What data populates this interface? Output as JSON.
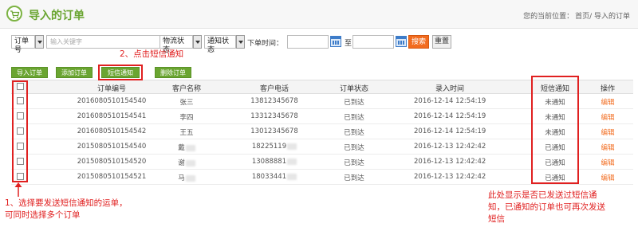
{
  "header": {
    "title": "导入的订单",
    "breadcrumb_prefix": "您的当前位置：",
    "breadcrumb_path": "首页/ 导入的订单"
  },
  "filter": {
    "field_select": "订单号",
    "search_placeholder": "输入关键字",
    "logistics_select": "物流状态",
    "notify_select": "通知状态",
    "time_label": "下单时间：",
    "range_sep": "至",
    "search_button": "搜索",
    "reset_button": "重置"
  },
  "actions": {
    "import": "导入订单",
    "add": "添加订单",
    "sms": "短信通知",
    "delete": "删除订单"
  },
  "table": {
    "columns": [
      "订单编号",
      "客户名称",
      "客户电话",
      "订单状态",
      "录入时间",
      "短信通知",
      "操作"
    ],
    "rows": [
      {
        "order": "2016080510154540",
        "name": "张三",
        "phone": "13812345678",
        "status": "已到达",
        "time": "2016-12-14 12:54:19",
        "sms": "未通知",
        "op": "编辑"
      },
      {
        "order": "2016080510154541",
        "name": "李四",
        "phone": "13312345678",
        "status": "已到达",
        "time": "2016-12-14 12:54:19",
        "sms": "未通知",
        "op": "编辑"
      },
      {
        "order": "2016080510154542",
        "name": "王五",
        "phone": "13012345678",
        "status": "已到达",
        "time": "2016-12-14 12:54:19",
        "sms": "未通知",
        "op": "编辑"
      },
      {
        "order": "2015080510154540",
        "name": "戴",
        "phone": "18225119",
        "status": "已到达",
        "time": "2016-12-13 12:42:42",
        "sms": "已通知",
        "op": "编辑"
      },
      {
        "order": "2015080510154520",
        "name": "谢",
        "phone": "13088881",
        "status": "已到达",
        "time": "2016-12-13 12:42:42",
        "sms": "已通知",
        "op": "编辑"
      },
      {
        "order": "2015080510154521",
        "name": "马",
        "phone": "18033441",
        "status": "已到达",
        "time": "2016-12-13 12:42:42",
        "sms": "已通知",
        "op": "编辑"
      }
    ]
  },
  "annotations": {
    "step2": "2、点击短信通知",
    "step1_line1": "1、选择要发送短信通知的运单，",
    "step1_line2": "可同时选择多个订单",
    "right_line1": "此处显示是否已发送过短信通",
    "right_line2": "知，已通知的订单也可再次发送",
    "right_line3": "短信"
  },
  "colors": {
    "brand_green": "#6aa531",
    "accent_orange": "#f26b1e",
    "annotation_red": "#e02020"
  }
}
